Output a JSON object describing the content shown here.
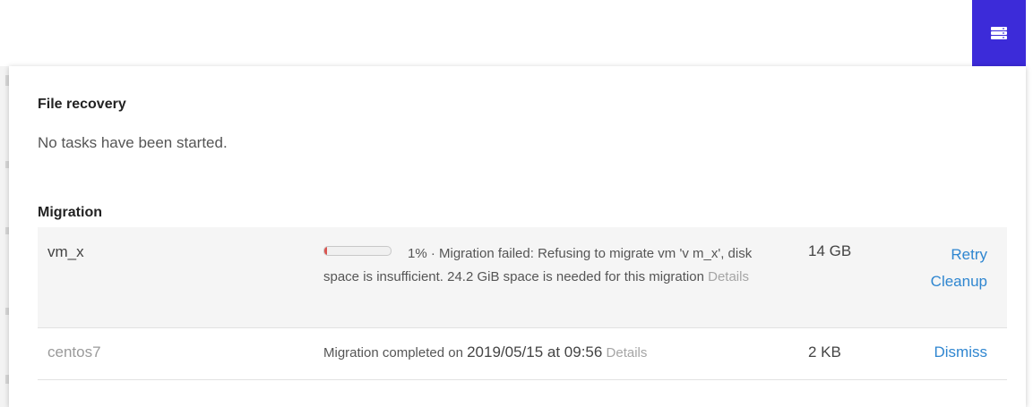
{
  "toolbar": {
    "tasks_button_icon": "server-tasks-icon",
    "accent_color": "#3c2bd9"
  },
  "file_recovery": {
    "title": "File recovery",
    "empty_message": "No tasks have been started."
  },
  "migration": {
    "title": "Migration",
    "rows": [
      {
        "name": "vm_x",
        "progress_percent": 1,
        "status_text": "1% · Migration failed: Refusing to migrate vm 'v m_x', disk space is insufficient. 24.2 GiB space is needed for this migration",
        "details_label": "Details",
        "size": "14 GB",
        "actions": [
          "Retry",
          "Cleanup"
        ]
      },
      {
        "name": "centos7",
        "status_prefix": "Migration completed on",
        "completed_at": "2019/05/15 at 09:56",
        "details_label": "Details",
        "size": "2 KB",
        "actions": [
          "Dismiss"
        ]
      }
    ]
  },
  "colors": {
    "link": "#2f86d0",
    "error": "#d9534f"
  }
}
